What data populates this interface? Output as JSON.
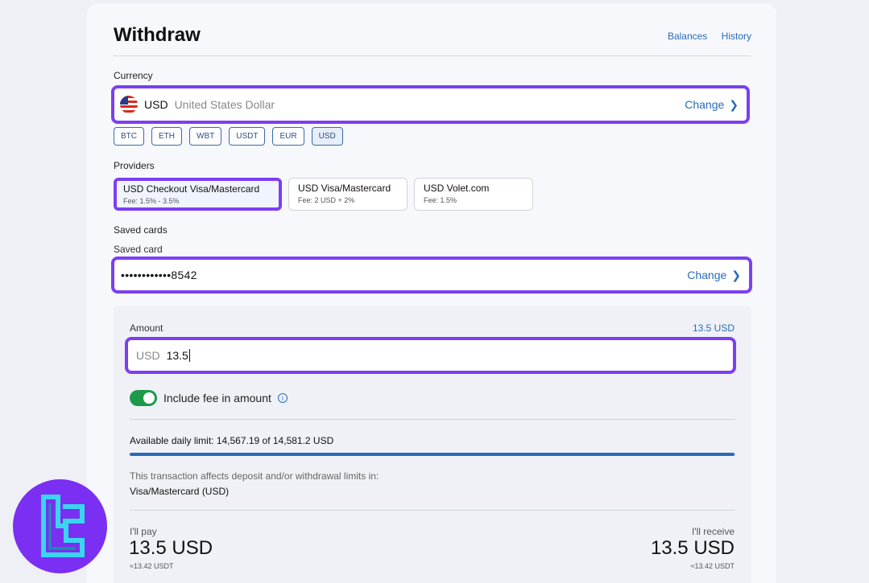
{
  "header": {
    "title": "Withdraw",
    "links": [
      "Balances",
      "History"
    ]
  },
  "currency": {
    "label": "Currency",
    "code": "USD",
    "name": "United States Dollar",
    "change": "Change",
    "chips": [
      "BTC",
      "ETH",
      "WBT",
      "USDT",
      "EUR",
      "USD"
    ],
    "selected_chip": "USD"
  },
  "providers": {
    "label": "Providers",
    "items": [
      {
        "name": "USD Checkout Visa/Mastercard",
        "fee": "Fee: 1.5% - 3.5%",
        "selected": true
      },
      {
        "name": "USD Visa/Mastercard",
        "fee": "Fee: 2 USD + 2%",
        "selected": false
      },
      {
        "name": "USD Volet.com",
        "fee": "Fee: 1.5%",
        "selected": false
      }
    ]
  },
  "saved_cards": {
    "label": "Saved cards",
    "sublabel": "Saved card",
    "number": "••••••••••••8542",
    "change": "Change"
  },
  "amount": {
    "label": "Amount",
    "max": "13.5 USD",
    "currency": "USD",
    "value": "13.5"
  },
  "include_fee": {
    "label": "Include fee in amount",
    "enabled": true
  },
  "limit": {
    "text": "Available daily limit: 14,567.19 of 14,581.2 USD",
    "progress_fraction": 0.999
  },
  "note": {
    "line1": "This transaction affects deposit and/or withdrawal limits in:",
    "line2": "Visa/Mastercard (USD)"
  },
  "summary": {
    "pay_label": "I'll pay",
    "pay_amount": "13.5 USD",
    "pay_sub": "≈13.42 USDT",
    "receive_label": "I'll receive",
    "receive_amount": "13.5 USD",
    "receive_sub": "≈13.42 USDT"
  },
  "colors": {
    "accent": "#7b3ff2",
    "link": "#2a6bb8",
    "toggle": "#1b9a4a"
  }
}
